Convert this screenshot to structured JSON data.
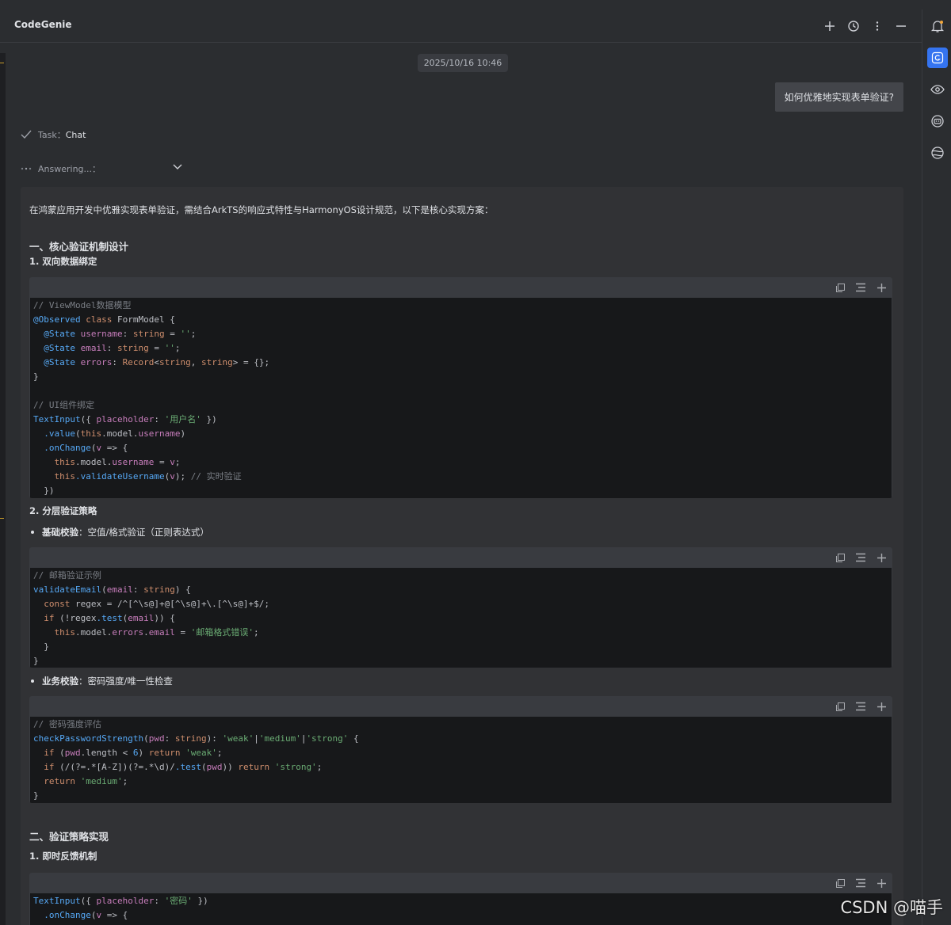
{
  "window": {
    "title": "CodeGenie"
  },
  "header": {
    "icons": [
      "plus-icon",
      "history-icon",
      "more-vertical-icon",
      "minimize-icon"
    ]
  },
  "chat": {
    "timestamp": "2025/10/16 10:46",
    "user_message": "如何优雅地实现表单验证?",
    "task_label": "Task：",
    "task_value": "Chat",
    "status": "Answering...："
  },
  "answer": {
    "intro": "在鸿蒙应用开发中优雅实现表单验证，需结合ArkTS的响应式特性与HarmonyOS设计规范，以下是核心实现方案：",
    "section1_title": "一、核心验证机制设计",
    "section1_sub1": "1. 双向数据绑定",
    "code1": [
      "// ViewModel数据模型",
      "@Observed class FormModel {",
      "  @State username: string = '';",
      "  @State email: string = '';",
      "  @State errors: Record<string, string> = {};",
      "}",
      "",
      "// UI组件绑定",
      "TextInput({ placeholder: '用户名' })",
      "  .value(this.model.username)",
      "  .onChange(v => {",
      "    this.model.username = v;",
      "    this.validateUsername(v); // 实时验证",
      "  })"
    ],
    "section1_sub2": "2. 分层验证策略",
    "bullet1_bold": "基础校验",
    "bullet1_rest": "：空值/格式验证（正则表达式）",
    "code2": [
      "// 邮箱验证示例",
      "validateEmail(email: string) {",
      "  const regex = /^[^\\s@]+@[^\\s@]+\\.[^\\s@]+$/;",
      "  if (!regex.test(email)) {",
      "    this.model.errors.email = '邮箱格式错误';",
      "  }",
      "}"
    ],
    "bullet2_bold": "业务校验",
    "bullet2_rest": "：密码强度/唯一性检查",
    "code3": [
      "// 密码强度评估",
      "checkPasswordStrength(pwd: string): 'weak'|'medium'|'strong' {",
      "  if (pwd.length < 6) return 'weak';",
      "  if (/(?=.*[A-Z])(?=.*\\d)/.test(pwd)) return 'strong';",
      "  return 'medium';",
      "}"
    ],
    "section2_title": "二、验证策略实现",
    "section2_sub1": "1. 即时反馈机制",
    "code4": [
      "TextInput({ placeholder: '密码' })",
      "  .onChange(v => {"
    ]
  },
  "sidebar": {
    "icons": [
      "notification-bell-icon",
      "codegenie-icon",
      "eye-icon",
      "ai-assistant-icon",
      "globe-icon"
    ]
  },
  "watermark": "CSDN @喵手",
  "colors": {
    "background": "#2b2d30",
    "accent": "#3574f0",
    "code_bg": "#17181a",
    "keyword": "#cf8e6d",
    "function": "#56a8f5",
    "string": "#6aab73",
    "comment": "#7a7e85",
    "decorator": "#57aaf7"
  }
}
